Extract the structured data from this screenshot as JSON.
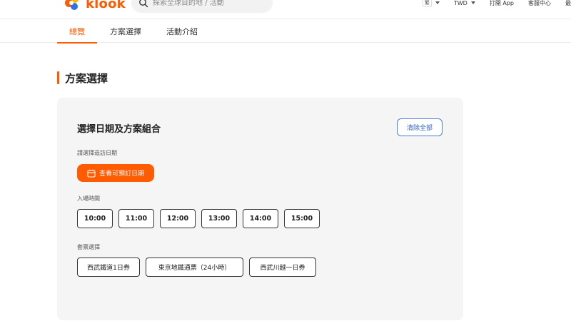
{
  "header": {
    "logo_text": "klook",
    "search_placeholder": "探索全球目的地 / 活動",
    "language_badge": "繁",
    "currency": "TWD",
    "open_app": "打開 App",
    "customer_service": "客服中心",
    "recent": "最近"
  },
  "tabs": [
    {
      "label": "總覽",
      "active": true
    },
    {
      "label": "方案選擇",
      "active": false
    },
    {
      "label": "活動介紹",
      "active": false
    }
  ],
  "section": {
    "title": "方案選擇"
  },
  "panel": {
    "title": "選擇日期及方案組合",
    "clear_label": "清除全部",
    "date_label": "請選擇造訪日期",
    "date_button": "查看可預訂日期",
    "time_label": "入場時間",
    "times": [
      "10:00",
      "11:00",
      "12:00",
      "13:00",
      "14:00",
      "15:00"
    ],
    "package_label": "套票選擇",
    "packages": [
      "西武鐵道1日券",
      "東京地鐵通票（24小時）",
      "西武川越一日券"
    ]
  },
  "colors": {
    "accent": "#ff5b00",
    "link_blue": "#2b5fc4"
  },
  "icons": [
    "klook-logo-icon",
    "search-icon",
    "calendar-icon",
    "chevron-down-icon"
  ]
}
